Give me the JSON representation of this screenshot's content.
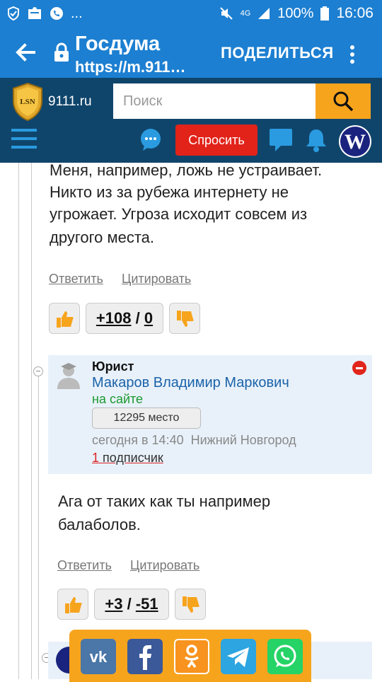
{
  "status_bar": {
    "network": "4G",
    "battery": "100%",
    "time": "16:06",
    "dots": "..."
  },
  "app_bar": {
    "title": "Госдума",
    "url": "https://m.911…",
    "share_label": "ПОДЕЛИТЬСЯ"
  },
  "site_header": {
    "site_name": "9111.ru",
    "logo_text": "LSN",
    "search_placeholder": "Поиск",
    "ask_label": "Спросить",
    "avatar_letter": "W"
  },
  "post1": {
    "lines": [
      "Меня, например, ложь не устраивает.",
      "Никто из за рубежа интернету не",
      "угрожает. Угроза исходит совсем из",
      "другого места."
    ],
    "reply_label": "Ответить",
    "quote_label": "Цитировать",
    "score_up": "+108",
    "score_down": "0"
  },
  "comment": {
    "role": "Юрист",
    "author": "Макаров Владимир Маркович",
    "online_status": "на сайте",
    "rank": "12295 место",
    "meta_time": "сегодня в 14:40",
    "meta_city": "Нижний Новгород",
    "subscribers_count": "1",
    "subscribers_label": "подписчик",
    "text_lines": [
      "Ага от таких как ты например",
      "балаболов."
    ],
    "reply_label": "Ответить",
    "quote_label": "Цитировать",
    "score_up": "+3",
    "score_down": "-51"
  },
  "share_panel": {
    "buttons": [
      {
        "icon": "vk-icon",
        "color": "#4a76a8"
      },
      {
        "icon": "facebook-icon",
        "color": "#3b5998"
      },
      {
        "icon": "odnoklassniki-icon",
        "color": "#f7931e"
      },
      {
        "icon": "telegram-icon",
        "color": "#2ca5e0"
      },
      {
        "icon": "whatsapp-icon",
        "color": "#25d366"
      }
    ]
  },
  "colors": {
    "app_bar": "#1c7fd1",
    "site_bar": "#10456b",
    "accent_orange": "#f7a41d",
    "ask_red": "#e2231a",
    "link_blue": "#1a62a8",
    "online_green": "#1b9a2f"
  }
}
